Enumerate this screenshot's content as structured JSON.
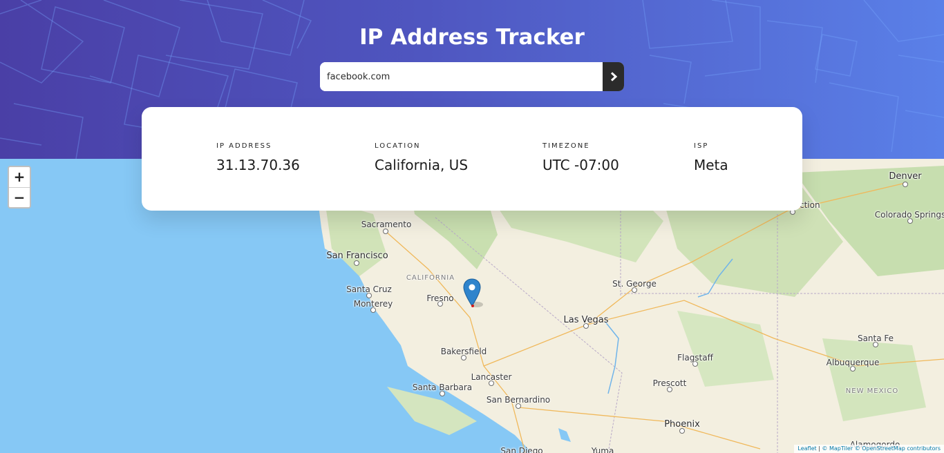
{
  "header": {
    "title": "IP Address Tracker",
    "search_value": "facebook.com",
    "search_button_icon": "chevron-right-icon"
  },
  "info": [
    {
      "label": "IP ADDRESS",
      "value": "31.13.70.36"
    },
    {
      "label": "LOCATION",
      "value": "California, US"
    },
    {
      "label": "TIMEZONE",
      "value": "UTC -07:00"
    },
    {
      "label": "ISP",
      "value": "Meta"
    }
  ],
  "map": {
    "zoom_in": "+",
    "zoom_out": "−",
    "marker_icon": "map-pin-icon",
    "places": {
      "denver": "Denver",
      "junction": "nction",
      "colorado_springs": "Colorado Springs",
      "sacramento": "Sacramento",
      "san_francisco": "San Francisco",
      "california": "CALIFORNIA",
      "santa_cruz": "Santa Cruz",
      "monterey": "Monterey",
      "fresno": "Fresno",
      "st_george": "St. George",
      "las_vegas": "Las Vegas",
      "santa_fe": "Santa Fe",
      "flagstaff": "Flagstaff",
      "albuquerque": "Albuquerque",
      "bakersfield": "Bakersfield",
      "new_mexico": "NEW MEXICO",
      "prescott": "Prescott",
      "lancaster": "Lancaster",
      "santa_barbara": "Santa Barbara",
      "san_bernardino": "San Bernardino",
      "phoenix": "Phoenix",
      "alamogordo": "Alamogordo",
      "san_diego": "San Diego",
      "yuma": "Yuma"
    },
    "attribution": {
      "leaflet": "Leaflet",
      "sep": " | ",
      "maptiler": "© MapTiler",
      "osm": "© OpenStreetMap contributors"
    }
  },
  "colors": {
    "header_start": "#4a3fa6",
    "header_end": "#5a80e8",
    "ocean": "#86c8f5",
    "land": "#f3efe0",
    "button": "#2b2b2b",
    "marker": "#2f84cc"
  }
}
